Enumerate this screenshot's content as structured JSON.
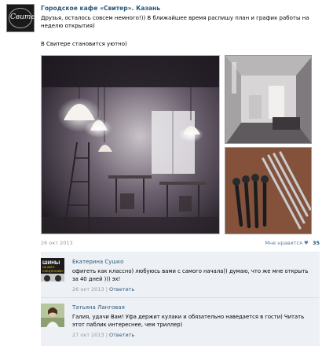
{
  "post": {
    "author": "Городское кафе «Свитер». Казань",
    "text": "Друзья, осталось совсем немного!)) В ближайшее время распишу план и график работы на неделю открытия)",
    "text2": "В Свитере становится уютно)",
    "date": "26 окт 2013",
    "likes_label": "Мне нравится",
    "likes_count": "35",
    "heart_glyph": "♥",
    "avatar_logo": "Свитер"
  },
  "comments": [
    {
      "name": "Екатерина Сушко",
      "text": "офигеть как классно) любуюсь вами с самого начала)) думаю, что же мне открыть за 40 дней ))) эх!",
      "date": "26 окт 2013",
      "separator": " | ",
      "reply": "Ответить",
      "avatar_text1": "ШИНЫ",
      "avatar_text2": "НА АВТО",
      "avatar_text3": "СПЕЦТЕХНИКУ"
    },
    {
      "name": "Татьяна Ланговая",
      "text": "Галия, удачи Вам! Уфа держит кулаки и обязательно наведается в гости) Читать этот паблик интереснее, чем триллер)",
      "date": "27 окт 2013",
      "separator": " | ",
      "reply": "Ответить"
    }
  ]
}
